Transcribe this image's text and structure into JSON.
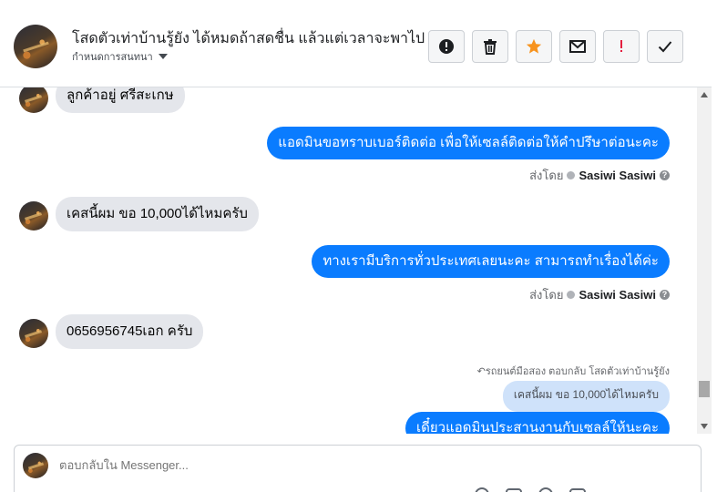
{
  "header": {
    "title": "โสดตัวเท่าบ้านรู้ยัง ได้หมดถ้าสดชื่น แล้วแต่เวลาจะพาไป",
    "assign_label": "กำหนดการสนทนา",
    "toolbar": {
      "spam_icon": "exclamation-circle-icon",
      "delete_icon": "trash-icon",
      "star_icon": "star-icon",
      "star_color": "#f7931e",
      "unread_icon": "envelope-icon",
      "follow_up_icon": "exclamation-icon",
      "follow_up_color": "#e41e3f",
      "done_icon": "check-icon"
    }
  },
  "messages": [
    {
      "from": "customer",
      "text": "ลูกค้าอยู่ ศรีสะเกษ"
    },
    {
      "from": "page",
      "text": "แอดมินขอทราบเบอร์ติดต่อ เพื่อให้เซลล์ติดต่อให้คำปรึษาต่อนะคะ",
      "sent_by_label": "ส่งโดย",
      "sender": "Sasiwi Sasiwi"
    },
    {
      "from": "customer",
      "text": "เคสนี้ผม ขอ 10,000ได้ไหมครับ"
    },
    {
      "from": "page",
      "text": "ทางเรามีบริการทั่วประเทศเลยนะคะ สามารถทำเรื่องได้ค่ะ",
      "sent_by_label": "ส่งโดย",
      "sender": "Sasiwi Sasiwi"
    },
    {
      "from": "customer",
      "text": "0656956745เอก ครับ"
    },
    {
      "from": "page",
      "reply_note": "รถยนต์มือสอง ตอบกลับ โสดตัวเท่าบ้านรู้ยัง",
      "quoted": "เคสนี้ผม ขอ 10,000ได้ไหมครับ",
      "text": "เดี๋ยวแอดมินประสานงานกับเซลล์ให้นะคะ"
    }
  ],
  "composer": {
    "placeholder": "ตอบกลับใน Messenger..."
  },
  "colors": {
    "outgoing_bubble": "#0a7cff",
    "incoming_bubble": "#e4e6eb",
    "quoted_bubble": "#cfe2fa"
  }
}
